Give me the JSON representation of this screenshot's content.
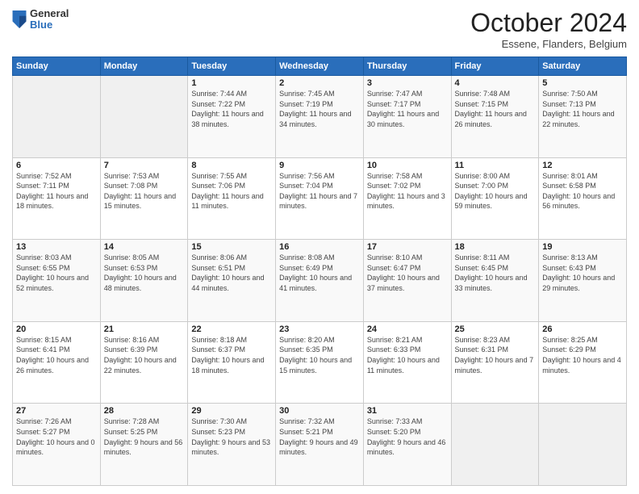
{
  "logo": {
    "general": "General",
    "blue": "Blue"
  },
  "title": "October 2024",
  "location": "Essene, Flanders, Belgium",
  "days_header": [
    "Sunday",
    "Monday",
    "Tuesday",
    "Wednesday",
    "Thursday",
    "Friday",
    "Saturday"
  ],
  "weeks": [
    [
      {
        "num": "",
        "info": ""
      },
      {
        "num": "",
        "info": ""
      },
      {
        "num": "1",
        "info": "Sunrise: 7:44 AM\nSunset: 7:22 PM\nDaylight: 11 hours and 38 minutes."
      },
      {
        "num": "2",
        "info": "Sunrise: 7:45 AM\nSunset: 7:19 PM\nDaylight: 11 hours and 34 minutes."
      },
      {
        "num": "3",
        "info": "Sunrise: 7:47 AM\nSunset: 7:17 PM\nDaylight: 11 hours and 30 minutes."
      },
      {
        "num": "4",
        "info": "Sunrise: 7:48 AM\nSunset: 7:15 PM\nDaylight: 11 hours and 26 minutes."
      },
      {
        "num": "5",
        "info": "Sunrise: 7:50 AM\nSunset: 7:13 PM\nDaylight: 11 hours and 22 minutes."
      }
    ],
    [
      {
        "num": "6",
        "info": "Sunrise: 7:52 AM\nSunset: 7:11 PM\nDaylight: 11 hours and 18 minutes."
      },
      {
        "num": "7",
        "info": "Sunrise: 7:53 AM\nSunset: 7:08 PM\nDaylight: 11 hours and 15 minutes."
      },
      {
        "num": "8",
        "info": "Sunrise: 7:55 AM\nSunset: 7:06 PM\nDaylight: 11 hours and 11 minutes."
      },
      {
        "num": "9",
        "info": "Sunrise: 7:56 AM\nSunset: 7:04 PM\nDaylight: 11 hours and 7 minutes."
      },
      {
        "num": "10",
        "info": "Sunrise: 7:58 AM\nSunset: 7:02 PM\nDaylight: 11 hours and 3 minutes."
      },
      {
        "num": "11",
        "info": "Sunrise: 8:00 AM\nSunset: 7:00 PM\nDaylight: 10 hours and 59 minutes."
      },
      {
        "num": "12",
        "info": "Sunrise: 8:01 AM\nSunset: 6:58 PM\nDaylight: 10 hours and 56 minutes."
      }
    ],
    [
      {
        "num": "13",
        "info": "Sunrise: 8:03 AM\nSunset: 6:55 PM\nDaylight: 10 hours and 52 minutes."
      },
      {
        "num": "14",
        "info": "Sunrise: 8:05 AM\nSunset: 6:53 PM\nDaylight: 10 hours and 48 minutes."
      },
      {
        "num": "15",
        "info": "Sunrise: 8:06 AM\nSunset: 6:51 PM\nDaylight: 10 hours and 44 minutes."
      },
      {
        "num": "16",
        "info": "Sunrise: 8:08 AM\nSunset: 6:49 PM\nDaylight: 10 hours and 41 minutes."
      },
      {
        "num": "17",
        "info": "Sunrise: 8:10 AM\nSunset: 6:47 PM\nDaylight: 10 hours and 37 minutes."
      },
      {
        "num": "18",
        "info": "Sunrise: 8:11 AM\nSunset: 6:45 PM\nDaylight: 10 hours and 33 minutes."
      },
      {
        "num": "19",
        "info": "Sunrise: 8:13 AM\nSunset: 6:43 PM\nDaylight: 10 hours and 29 minutes."
      }
    ],
    [
      {
        "num": "20",
        "info": "Sunrise: 8:15 AM\nSunset: 6:41 PM\nDaylight: 10 hours and 26 minutes."
      },
      {
        "num": "21",
        "info": "Sunrise: 8:16 AM\nSunset: 6:39 PM\nDaylight: 10 hours and 22 minutes."
      },
      {
        "num": "22",
        "info": "Sunrise: 8:18 AM\nSunset: 6:37 PM\nDaylight: 10 hours and 18 minutes."
      },
      {
        "num": "23",
        "info": "Sunrise: 8:20 AM\nSunset: 6:35 PM\nDaylight: 10 hours and 15 minutes."
      },
      {
        "num": "24",
        "info": "Sunrise: 8:21 AM\nSunset: 6:33 PM\nDaylight: 10 hours and 11 minutes."
      },
      {
        "num": "25",
        "info": "Sunrise: 8:23 AM\nSunset: 6:31 PM\nDaylight: 10 hours and 7 minutes."
      },
      {
        "num": "26",
        "info": "Sunrise: 8:25 AM\nSunset: 6:29 PM\nDaylight: 10 hours and 4 minutes."
      }
    ],
    [
      {
        "num": "27",
        "info": "Sunrise: 7:26 AM\nSunset: 5:27 PM\nDaylight: 10 hours and 0 minutes."
      },
      {
        "num": "28",
        "info": "Sunrise: 7:28 AM\nSunset: 5:25 PM\nDaylight: 9 hours and 56 minutes."
      },
      {
        "num": "29",
        "info": "Sunrise: 7:30 AM\nSunset: 5:23 PM\nDaylight: 9 hours and 53 minutes."
      },
      {
        "num": "30",
        "info": "Sunrise: 7:32 AM\nSunset: 5:21 PM\nDaylight: 9 hours and 49 minutes."
      },
      {
        "num": "31",
        "info": "Sunrise: 7:33 AM\nSunset: 5:20 PM\nDaylight: 9 hours and 46 minutes."
      },
      {
        "num": "",
        "info": ""
      },
      {
        "num": "",
        "info": ""
      }
    ]
  ]
}
